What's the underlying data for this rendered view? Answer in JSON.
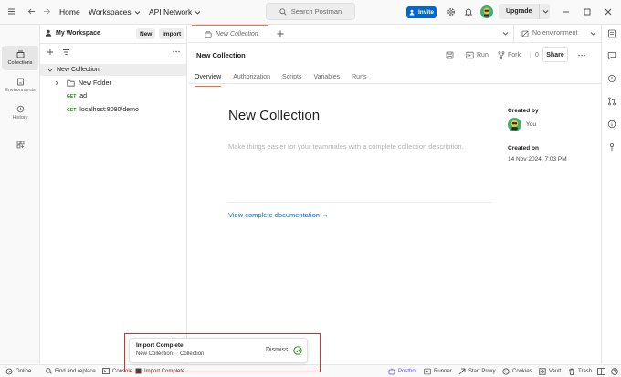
{
  "topbar": {
    "home": "Home",
    "workspaces": "Workspaces",
    "api_network": "API Network",
    "search_placeholder": "Search Postman",
    "invite": "Invite",
    "upgrade": "Upgrade"
  },
  "rail": {
    "collections": "Collections",
    "environments": "Environments",
    "history": "History"
  },
  "sidebar": {
    "workspace": "My Workspace",
    "new_btn": "New",
    "import_btn": "Import",
    "collection": "New Collection",
    "folder": "New Folder",
    "requests": [
      {
        "method": "GET",
        "name": "ad"
      },
      {
        "method": "GET",
        "name": "localhost:8080/demo"
      }
    ]
  },
  "tabs": {
    "active": "New Collection",
    "environment": "No environment"
  },
  "header": {
    "title": "New Collection",
    "run": "Run",
    "fork": "Fork",
    "fork_count": "0",
    "share": "Share"
  },
  "subtabs": [
    "Overview",
    "Authorization",
    "Scripts",
    "Variables",
    "Runs"
  ],
  "overview": {
    "title": "New Collection",
    "description": "Make things easier for your teammates with a complete collection description.",
    "doc_link": "View complete documentation →",
    "created_by_label": "Created by",
    "created_by": "You",
    "created_on_label": "Created on",
    "created_on": "14 Nov 2024, 7:03 PM"
  },
  "toast": {
    "title": "Import Complete",
    "collection": "New Collection",
    "separator": "·",
    "type": "Collection",
    "dismiss": "Dismiss"
  },
  "status": {
    "online": "Online",
    "find": "Find and replace",
    "console": "Console",
    "import": "Import Complete",
    "postbot": "Postbot",
    "runner": "Runner",
    "start_proxy": "Start Proxy",
    "cookies": "Cookies",
    "vault": "Vault",
    "trash": "Trash"
  },
  "colors": {
    "accent": "#ff6c37",
    "primary": "#0265d2",
    "highlight": "#d62d2d"
  }
}
